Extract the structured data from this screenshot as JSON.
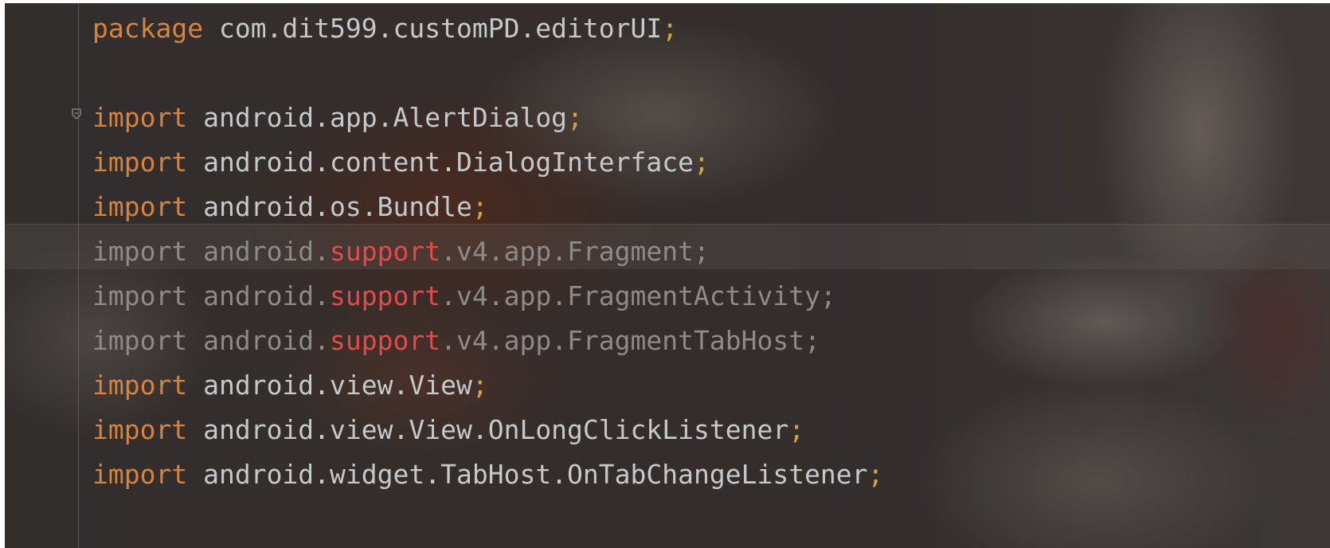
{
  "editor": {
    "lines": [
      {
        "keyword": "package",
        "path": "com.dit599.customPD.editorUI",
        "error_token": "",
        "rest": "",
        "semicolon": ";",
        "dim": false
      },
      {
        "keyword": "",
        "path": "",
        "error_token": "",
        "rest": "",
        "semicolon": "",
        "dim": false
      },
      {
        "keyword": "import",
        "path": "android.app.AlertDialog",
        "error_token": "",
        "rest": "",
        "semicolon": ";",
        "dim": false
      },
      {
        "keyword": "import",
        "path": "android.content.DialogInterface",
        "error_token": "",
        "rest": "",
        "semicolon": ";",
        "dim": false
      },
      {
        "keyword": "import",
        "path": "android.os.Bundle",
        "error_token": "",
        "rest": "",
        "semicolon": ";",
        "dim": false
      },
      {
        "keyword": "import",
        "path": "android.",
        "error_token": "support",
        "rest": ".v4.app.Fragment",
        "semicolon": ";",
        "dim": true
      },
      {
        "keyword": "import",
        "path": "android.",
        "error_token": "support",
        "rest": ".v4.app.FragmentActivity",
        "semicolon": ";",
        "dim": true
      },
      {
        "keyword": "import",
        "path": "android.",
        "error_token": "support",
        "rest": ".v4.app.FragmentTabHost",
        "semicolon": ";",
        "dim": true
      },
      {
        "keyword": "import",
        "path": "android.view.View",
        "error_token": "",
        "rest": "",
        "semicolon": ";",
        "dim": false
      },
      {
        "keyword": "import",
        "path": "android.view.View.OnLongClickListener",
        "error_token": "",
        "rest": "",
        "semicolon": ";",
        "dim": false
      },
      {
        "keyword": "import",
        "path": "android.widget.TabHost.OnTabChangeListener",
        "error_token": "",
        "rest": "",
        "semicolon": ";",
        "dim": false
      }
    ],
    "icons": {
      "fold": "fold-collapse-icon"
    },
    "colors": {
      "keyword": "#d6843d",
      "identifier": "#c5c9cc",
      "semicolon": "#d2a33e",
      "unresolved": "#e34a4a",
      "unused_import": "#8e8a87"
    }
  }
}
